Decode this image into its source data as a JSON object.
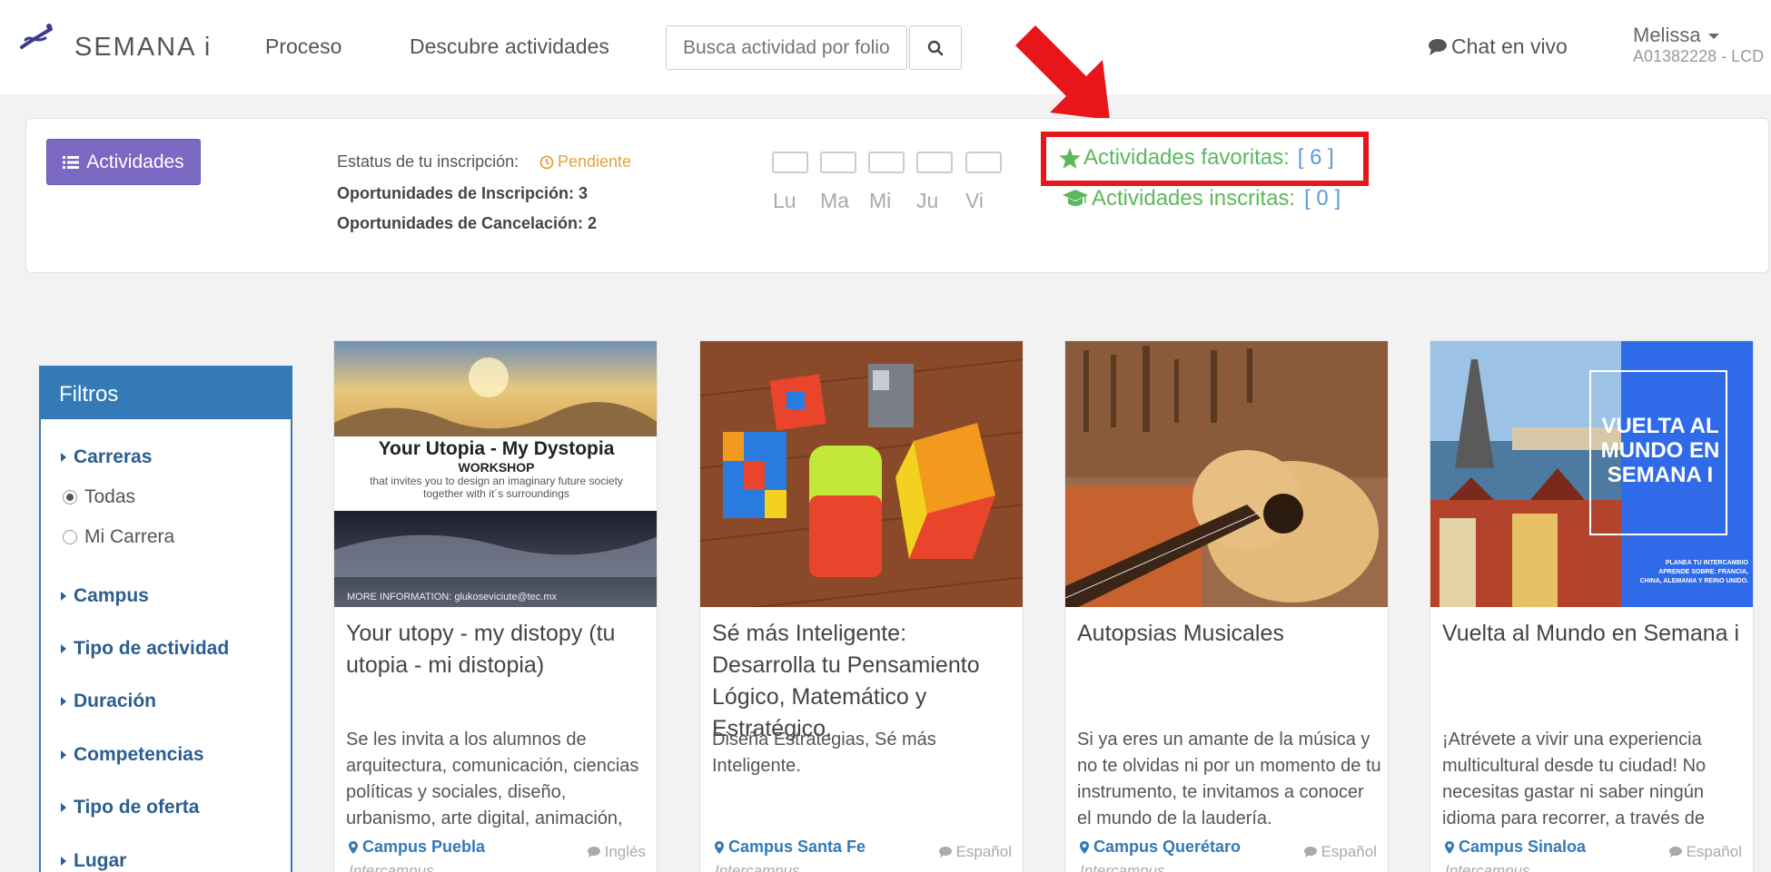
{
  "navbar": {
    "logo_text": "SEMANA i",
    "links": [
      "Proceso",
      "Descubre actividades"
    ],
    "search_placeholder": "Busca actividad por folio",
    "chat": "Chat en vivo",
    "user_name": "Melissa",
    "user_id": "A01382228 - LCD"
  },
  "status": {
    "button_label": "Actividades",
    "status_label": "Estatus de tu inscripción:",
    "status_value": "Pendiente",
    "inscription_opps": "Oportunidades de Inscripción: 3",
    "cancel_opps": "Oportunidades de Cancelación: 2",
    "days": [
      "Lu",
      "Ma",
      "Mi",
      "Ju",
      "Vi"
    ],
    "favorites_label": "Actividades favoritas:",
    "favorites_count": "[ 6 ]",
    "enrolled_label": "Actividades inscritas:",
    "enrolled_count": "[ 0 ]"
  },
  "filters": {
    "title": "Filtros",
    "carreras": "Carreras",
    "options": [
      "Todas",
      "Mi Carrera"
    ],
    "selected": "Todas",
    "sections": [
      "Campus",
      "Tipo de actividad",
      "Duración",
      "Competencias",
      "Tipo de oferta",
      "Lugar"
    ]
  },
  "cards": [
    {
      "title": "Your utopy - my distopy (tu utopia - mi distopia)",
      "description": "Se les invita a los alumnos de arquitectura, comunicación, ciencias políticas y sociales, diseño, urbanismo, arte digital, animación,",
      "campus": "Campus Puebla",
      "language": "Inglés",
      "subtitle": "Intercampus",
      "img_title": "Your Utopia - My Dystopia",
      "img_sub": "WORKSHOP",
      "img_text": "that invites you to design an imaginary future society together with it´s surroundings",
      "img_footer": "MORE INFORMATION:  glukoseviciute@tec.mx"
    },
    {
      "title": "Sé más Inteligente: Desarrolla tu Pensamiento Lógico, Matemático y Estratégico.",
      "description": "Diseña Estrategias, Sé más Inteligente.",
      "campus": "Campus Santa Fe",
      "language": "Español",
      "subtitle": "Intercampus"
    },
    {
      "title": "Autopsias Musicales",
      "description": "Si ya eres un amante de la música y no te olvidas ni por un momento de tu instrumento, te invitamos a conocer el mundo de la laudería.",
      "campus": "Campus Querétaro",
      "language": "Español",
      "subtitle": "Intercampus"
    },
    {
      "title": "Vuelta al Mundo en Semana i",
      "description": "¡Atrévete a vivir una experiencia multicultural desde tu ciudad! No necesitas gastar ni saber ningún idioma para recorrer, a través de",
      "campus": "Campus Sinaloa",
      "language": "Español",
      "subtitle": "Intercampus",
      "img_title": "VUELTA AL MUNDO EN SEMANA I",
      "img_small": "PLANEA TU INTERCAMBIO APRENDE SOBRE: FRANCIA, CHINA, ALEMANIA Y REINO UNIDO."
    }
  ],
  "colors": {
    "purple": "#7a68c2",
    "green": "#5cb85c",
    "blue": "#337ab7",
    "orange": "#e6a23c",
    "red": "#e8161b"
  }
}
